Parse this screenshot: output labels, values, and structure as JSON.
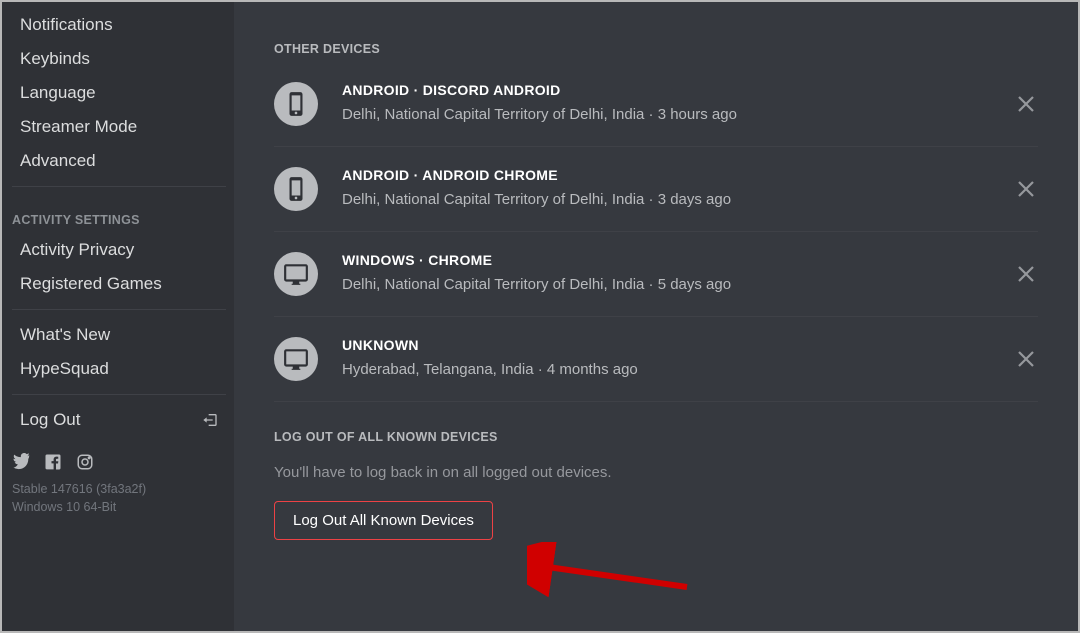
{
  "sidebar": {
    "items_top": [
      "Notifications",
      "Keybinds",
      "Language",
      "Streamer Mode",
      "Advanced"
    ],
    "activity_header": "ACTIVITY SETTINGS",
    "activity_items": [
      "Activity Privacy",
      "Registered Games"
    ],
    "misc_items": [
      "What's New",
      "HypeSquad"
    ],
    "log_out_label": "Log Out",
    "version_line1": "Stable 147616 (3fa3a2f)",
    "version_line2": "Windows 10 64-Bit"
  },
  "main": {
    "other_devices_header": "OTHER DEVICES",
    "devices": [
      {
        "icon": "phone",
        "title": "ANDROID · DISCORD ANDROID",
        "location": "Delhi, National Capital Territory of Delhi, India",
        "time": "3 hours ago"
      },
      {
        "icon": "phone",
        "title": "ANDROID · ANDROID CHROME",
        "location": "Delhi, National Capital Territory of Delhi, India",
        "time": "3 days ago"
      },
      {
        "icon": "desktop",
        "title": "WINDOWS · CHROME",
        "location": "Delhi, National Capital Territory of Delhi, India",
        "time": "5 days ago"
      },
      {
        "icon": "desktop",
        "title": "UNKNOWN",
        "location": "Hyderabad, Telangana, India",
        "time": "4 months ago"
      }
    ],
    "logout_all_header": "LOG OUT OF ALL KNOWN DEVICES",
    "logout_all_desc": "You'll have to log back in on all logged out devices.",
    "logout_all_btn": "Log Out All Known Devices"
  }
}
